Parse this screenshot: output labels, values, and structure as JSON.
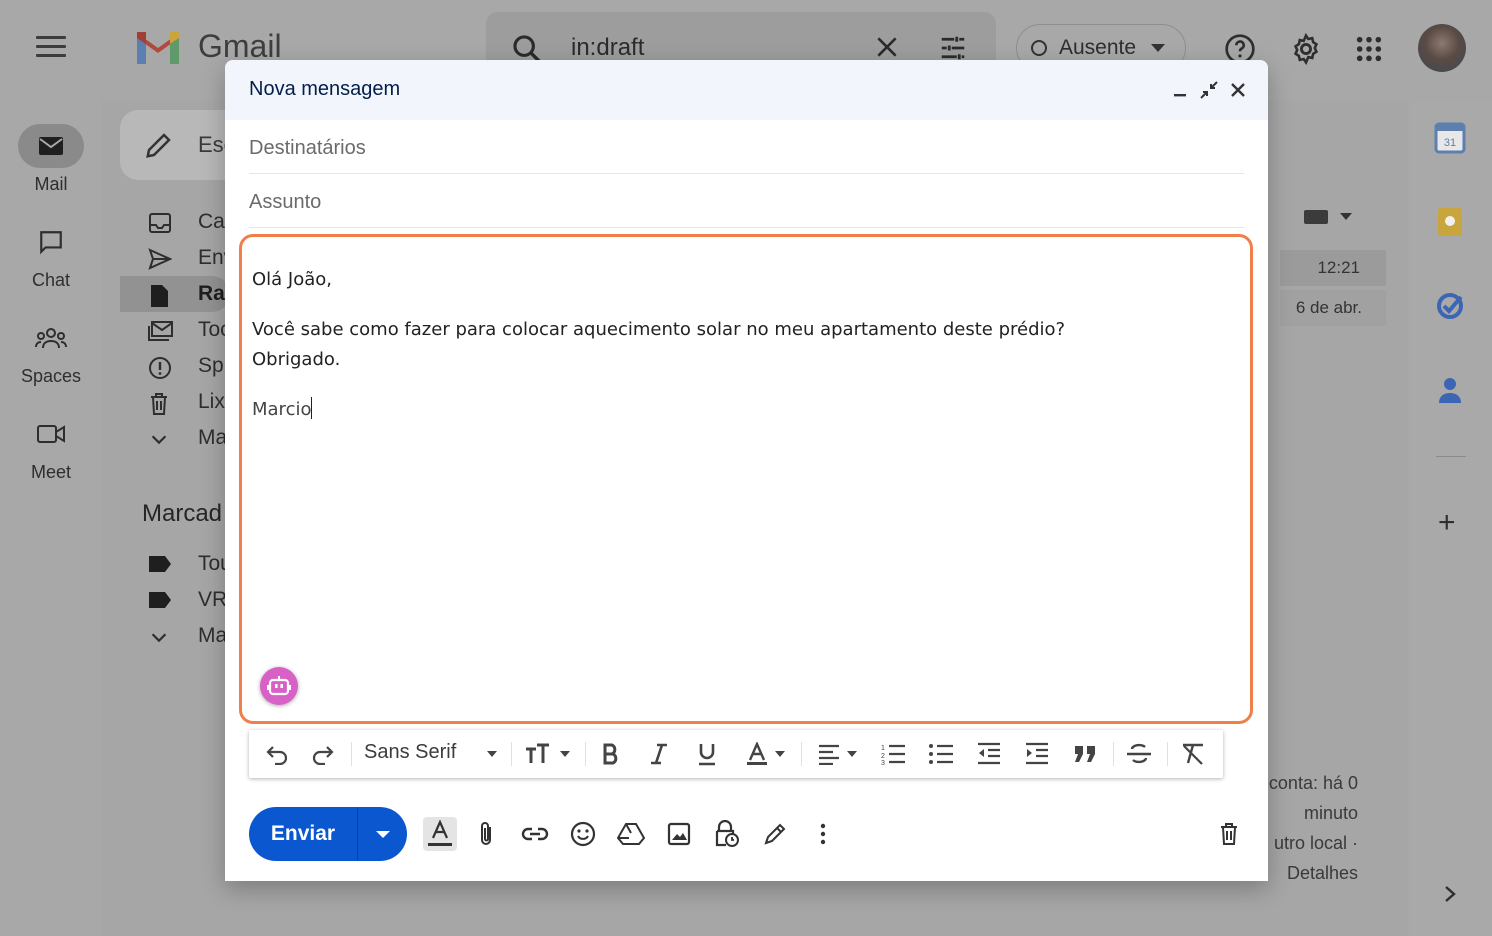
{
  "app": {
    "name": "Gmail"
  },
  "search": {
    "query": "in:draft"
  },
  "status": {
    "label": "Ausente"
  },
  "rail": [
    {
      "label": "Mail"
    },
    {
      "label": "Chat"
    },
    {
      "label": "Spaces"
    },
    {
      "label": "Meet"
    }
  ],
  "sidebar": {
    "compose_label": "Esc",
    "items": [
      {
        "label": "Ca"
      },
      {
        "label": "Env"
      },
      {
        "label": "Ra"
      },
      {
        "label": "Toc"
      },
      {
        "label": "Sp:"
      },
      {
        "label": "Lix"
      },
      {
        "label": "Ma"
      }
    ],
    "labels_heading": "Marcad",
    "labels": [
      {
        "label": "Tou"
      },
      {
        "label": "VR"
      },
      {
        "label": "Ma"
      }
    ]
  },
  "list": {
    "times": [
      "12:21",
      "6 de abr."
    ]
  },
  "footer": {
    "lines": [
      "conta: há 0",
      "minuto",
      "utro local ·",
      "Detalhes"
    ]
  },
  "compose": {
    "title": "Nova mensagem",
    "to_placeholder": "Destinatários",
    "subject_placeholder": "Assunto",
    "body": {
      "greeting": "Olá João,",
      "line1": "Você sabe como fazer para colocar aquecimento solar no meu apartamento deste prédio?",
      "line2": "Obrigado.",
      "signature": "Marcio"
    },
    "font": "Sans Serif",
    "send_label": "Enviar"
  },
  "colors": {
    "send_blue": "#0b57d0",
    "header_bg": "#f2f6fc",
    "focus_border": "#f07f4a",
    "assistant_pink": "#d960c6"
  }
}
